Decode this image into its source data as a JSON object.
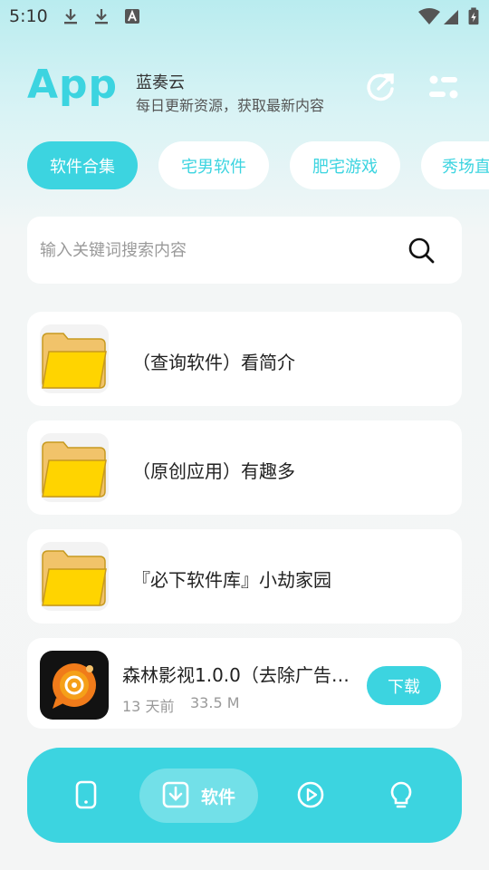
{
  "status_bar": {
    "time": "5:10",
    "icons": [
      "download-icon",
      "download-icon",
      "font-a-icon",
      "wifi-icon",
      "cell-signal-icon",
      "battery-charging-icon"
    ]
  },
  "header": {
    "logo": "App",
    "title": "蓝奏云",
    "subtitle": "每日更新资源，获取最新内容",
    "refresh_icon": "refresh-icon",
    "settings_icon": "settings-sliders-icon"
  },
  "tabs": [
    {
      "label": "软件合集",
      "active": true
    },
    {
      "label": "宅男软件",
      "active": false
    },
    {
      "label": "肥宅游戏",
      "active": false
    },
    {
      "label": "秀场直",
      "active": false
    }
  ],
  "search": {
    "placeholder": "输入关键词搜索内容",
    "value": "",
    "icon": "search-icon"
  },
  "folders": [
    {
      "label": "（查询软件）看简介",
      "icon": "folder-icon"
    },
    {
      "label": "（原创应用）有趣多",
      "icon": "folder-icon"
    },
    {
      "label": "『必下软件库』小劫家园",
      "icon": "folder-icon"
    }
  ],
  "apps": [
    {
      "title": "森林影视1.0.0（去除广告…",
      "time": "13 天前",
      "size": "33.5 M",
      "download_label": "下载",
      "icon": "forest-video-app-icon"
    }
  ],
  "bottom_nav": {
    "items": [
      {
        "icon": "phone-icon",
        "label": "",
        "active": false
      },
      {
        "icon": "download-box-icon",
        "label": "软件",
        "active": true
      },
      {
        "icon": "play-circle-icon",
        "label": "",
        "active": false
      },
      {
        "icon": "lightbulb-icon",
        "label": "",
        "active": false
      }
    ]
  },
  "colors": {
    "accent": "#3cd4e0",
    "folder_yellow": "#ffd400",
    "background": "#f4f5f5"
  }
}
